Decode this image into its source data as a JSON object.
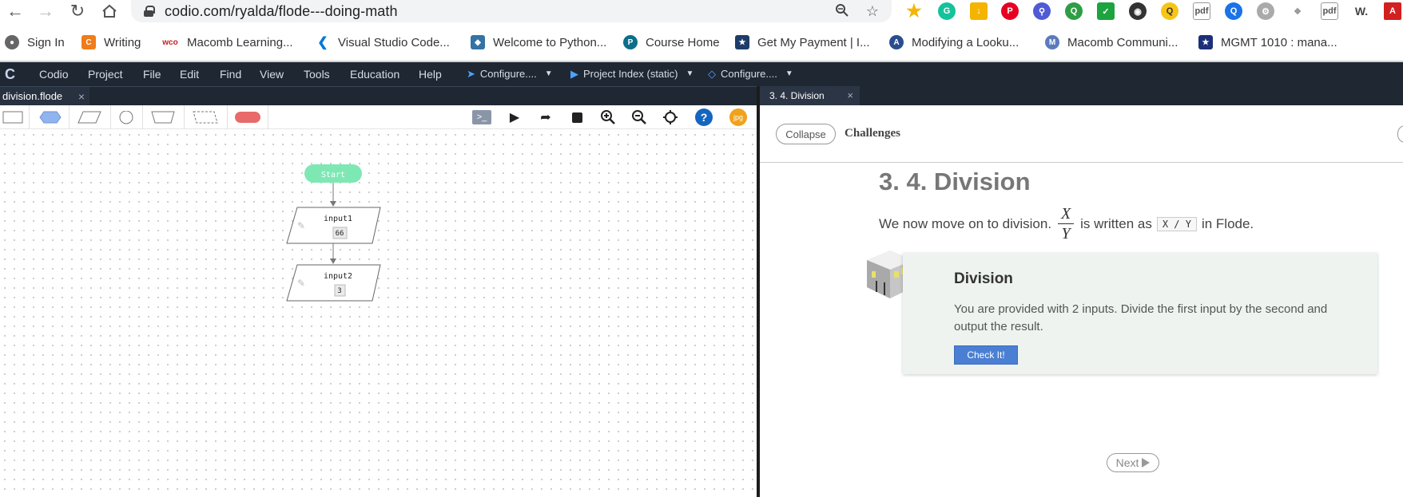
{
  "browser": {
    "url": "codio.com/ryalda/flode---doing-math",
    "bookmarks": [
      {
        "label": "Sign In",
        "icon": "globe-icon"
      },
      {
        "label": "Writing",
        "icon": "codio-icon"
      },
      {
        "label": "Macomb Learning...",
        "icon": "wco-icon"
      },
      {
        "label": "Visual Studio Code...",
        "icon": "vscode-icon"
      },
      {
        "label": "Welcome to Python...",
        "icon": "python-icon"
      },
      {
        "label": "Course Home",
        "icon": "pearson-icon"
      },
      {
        "label": "Get My Payment | I...",
        "icon": "irs-icon"
      },
      {
        "label": "Modifying a Looku...",
        "icon": "access-icon"
      },
      {
        "label": "Macomb Communi...",
        "icon": "macomb-icon"
      },
      {
        "label": "MGMT 1010 : mana...",
        "icon": "star-badge-icon"
      }
    ],
    "ext_w_label": "W.",
    "ext_jpg_label": "jpg"
  },
  "menubar": {
    "items": [
      "Codio",
      "Project",
      "File",
      "Edit",
      "Find",
      "View",
      "Tools",
      "Education",
      "Help"
    ],
    "configure1": "Configure....",
    "project_index": "Project Index (static)",
    "configure2": "Configure...."
  },
  "editor": {
    "tab": "division.flode",
    "start_label": "Start",
    "nodes": [
      {
        "name": "input1",
        "value": "66"
      },
      {
        "name": "input2",
        "value": "3"
      }
    ],
    "terminal_label": ">_",
    "help_label": "?",
    "jpg_label": "jpg"
  },
  "guide": {
    "tab": "3. 4. Division",
    "collapse": "Collapse",
    "challenges": "Challenges",
    "title": "3. 4. Division",
    "line_before": "We now move on to division.",
    "frac_num": "X",
    "frac_den": "Y",
    "line_mid": "is written as",
    "code": "X / Y",
    "line_after": "in Flode.",
    "card_title": "Division",
    "card_text": "You are provided with 2 inputs. Divide the first input by the second and output the result.",
    "check_button": "Check It!",
    "next": "Next"
  },
  "colors": {
    "menubar_bg": "#1f2733",
    "start_node": "#7ee8b4",
    "check_button": "#4a7fd4",
    "card_bg": "#eef3ef",
    "terminator_shape": "#e86a6a",
    "decision_shape": "#8fb4f0"
  }
}
